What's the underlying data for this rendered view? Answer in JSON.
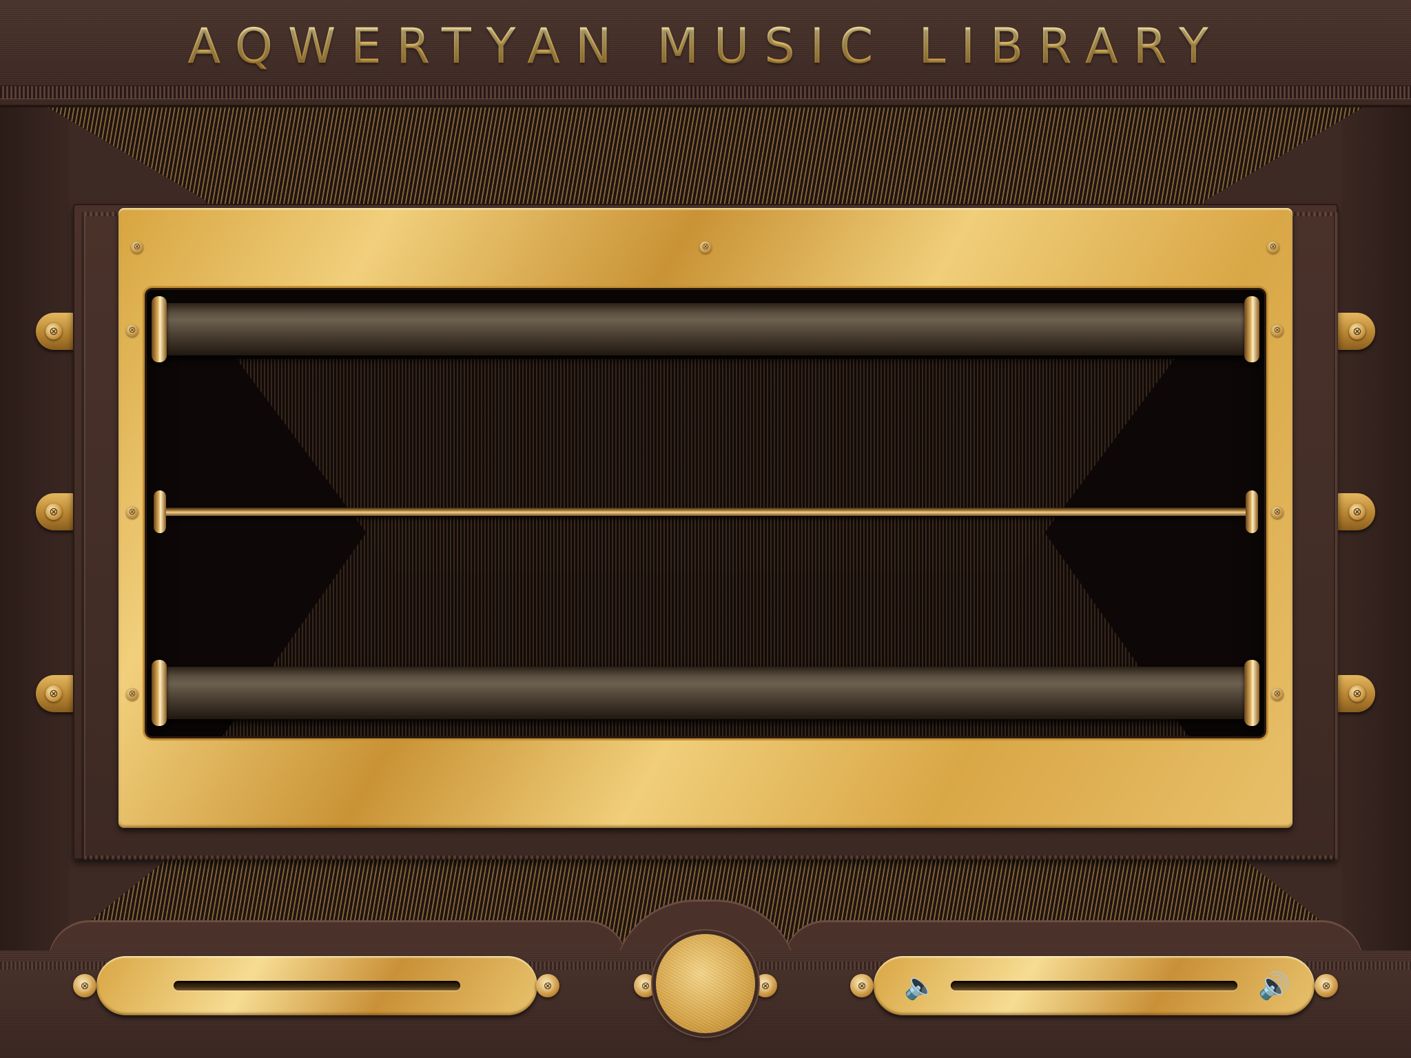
{
  "app": {
    "title": "AQWERTYAN MUSIC LIBRARY"
  },
  "colors": {
    "wood": "#3e2a24",
    "brass": "#d9a644",
    "window": "#0d0807"
  },
  "shelf": {
    "rollers": [
      "top-roller",
      "center-rod",
      "bottom-roller"
    ]
  },
  "playback": {
    "progress": 0.0
  },
  "volume": {
    "level": 0.0,
    "low_icon": "speaker-low-icon",
    "high_icon": "speaker-high-icon",
    "low_glyph": "🔈",
    "high_glyph": "🔊"
  },
  "icons": {
    "screw": "screw-icon",
    "screw_glyph": "⊗"
  }
}
